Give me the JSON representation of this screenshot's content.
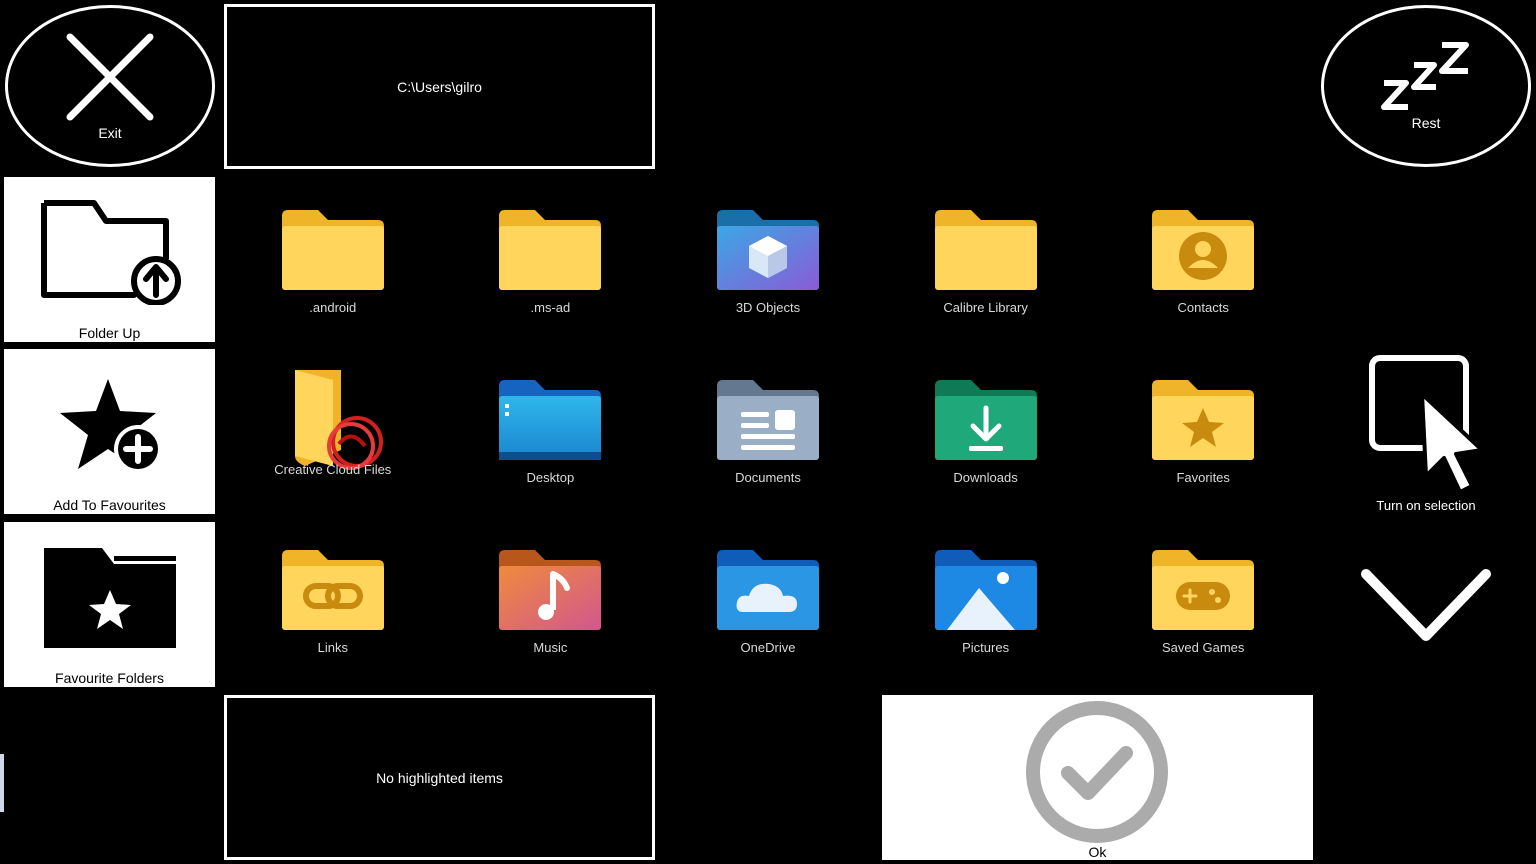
{
  "header": {
    "exit_label": "Exit",
    "path": "C:\\Users\\gilro",
    "rest_label": "Rest"
  },
  "sidebar": {
    "folder_up_label": "Folder Up",
    "add_favourites_label": "Add To Favourites",
    "favourite_folders_label": "Favourite Folders"
  },
  "folders": [
    {
      "name": ".android",
      "icon": "folder-icon"
    },
    {
      "name": ".ms-ad",
      "icon": "folder-icon"
    },
    {
      "name": "3D Objects",
      "icon": "3d-objects-folder-icon"
    },
    {
      "name": "Calibre Library",
      "icon": "folder-icon"
    },
    {
      "name": "Contacts",
      "icon": "contacts-folder-icon"
    },
    {
      "name": "Creative Cloud Files",
      "icon": "creative-cloud-folder-icon"
    },
    {
      "name": "Desktop",
      "icon": "desktop-folder-icon"
    },
    {
      "name": "Documents",
      "icon": "documents-folder-icon"
    },
    {
      "name": "Downloads",
      "icon": "downloads-folder-icon"
    },
    {
      "name": "Favorites",
      "icon": "favorites-folder-icon"
    },
    {
      "name": "Links",
      "icon": "links-folder-icon"
    },
    {
      "name": "Music",
      "icon": "music-folder-icon"
    },
    {
      "name": "OneDrive",
      "icon": "onedrive-folder-icon"
    },
    {
      "name": "Pictures",
      "icon": "pictures-folder-icon"
    },
    {
      "name": "Saved Games",
      "icon": "saved-games-folder-icon"
    }
  ],
  "right_panel": {
    "selection_label": "Turn on selection"
  },
  "footer": {
    "highlight_status": "No highlighted items",
    "ok_label": "Ok"
  },
  "colors": {
    "background": "#000000",
    "folder_yellow": "#FFD55C",
    "folder_yellow_tab": "#F0B429",
    "ok_grey": "#ABABAB"
  }
}
